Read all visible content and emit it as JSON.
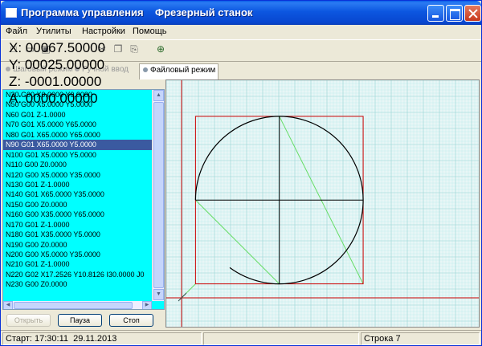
{
  "window": {
    "title": "Программа управления    Фрезерный станок"
  },
  "menu": [
    "Файл",
    "Утилиты",
    "Настройки",
    "Помощь"
  ],
  "tabs": {
    "manual": "Шаговый режим",
    "input": "Ручной ввод",
    "file": "Файловый режим"
  },
  "coords": {
    "x": "X: 00067.50000",
    "y": "Y: 00025.00000",
    "z": "Z: -0001.00000",
    "a": "A: 0000.00000"
  },
  "program": {
    "lines": [
      "N20 G00 X0.0000 Y0.0000",
      "N50 G00 X5.0000 Y5.0000",
      "N60 G01 Z-1.0000",
      "N70 G01 X5.0000 Y65.0000",
      "N80 G01 X65.0000 Y65.0000",
      "N90 G01 X65.0000 Y5.0000",
      "N100 G01 X5.0000 Y5.0000",
      "N110 G00 Z0.0000",
      "N120 G00 X5.0000 Y35.0000",
      "N130 G01 Z-1.0000",
      "N140 G01 X65.0000 Y35.0000",
      "N150 G00 Z0.0000",
      "N160 G00 X35.0000 Y65.0000",
      "N170 G01 Z-1.0000",
      "N180 G01 X35.0000 Y5.0000",
      "N190 G00 Z0.0000",
      "N200 G00 X5.0000 Y35.0000",
      "N210 G01 Z-1.0000",
      "N220 G02 X17.2526 Y10.8126 I30.0000 J0",
      "N230 G00 Z0.0000"
    ],
    "selected_index": 5
  },
  "buttons": {
    "open": "Открыть",
    "pause": "Пауза",
    "stop": "Стоп"
  },
  "status": {
    "start": "Старт: 17:30:11  29.11.2013",
    "empty": "",
    "line": "Строка 7"
  },
  "colors": {
    "titlebar": "#0a5fe8",
    "program_bg": "#00ffff",
    "selection": "#3a5aa0",
    "grid": "#9fd8d8",
    "axis": "#cc0000",
    "toolpath": "#000000",
    "rapid": "#66dd66"
  },
  "icons": [
    "new-file-icon",
    "open-file-icon",
    "save-icon",
    "cut-icon",
    "copy-icon",
    "paste-icon",
    "zoom-icon"
  ],
  "drawing": {
    "square": {
      "x": [
        5,
        65
      ],
      "y": [
        5,
        65
      ]
    },
    "circle": {
      "center": [
        35,
        35
      ],
      "radius": 30
    },
    "hline": {
      "y": 35,
      "x": [
        5,
        65
      ]
    },
    "vline": {
      "x": 35,
      "y": [
        5,
        65
      ]
    }
  }
}
